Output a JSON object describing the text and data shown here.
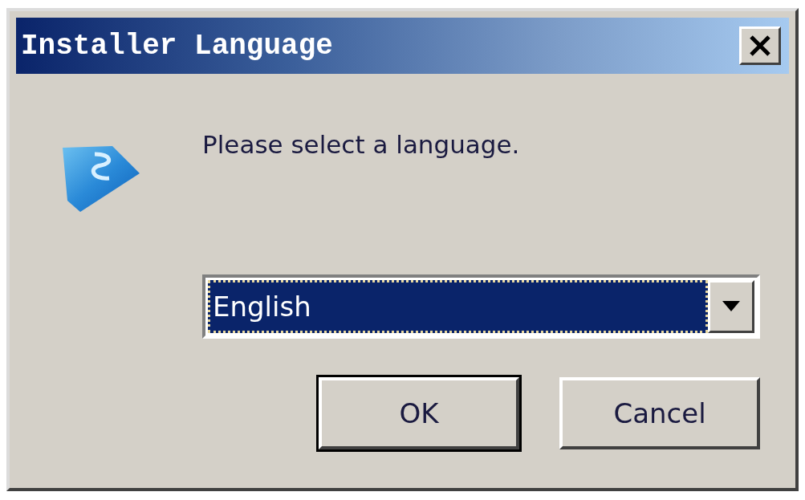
{
  "window": {
    "title": "Installer Language"
  },
  "message": "Please select a language.",
  "language_select": {
    "value": "English"
  },
  "buttons": [
    {
      "label": "OK",
      "default": true
    },
    {
      "label": "Cancel",
      "default": false
    }
  ]
}
